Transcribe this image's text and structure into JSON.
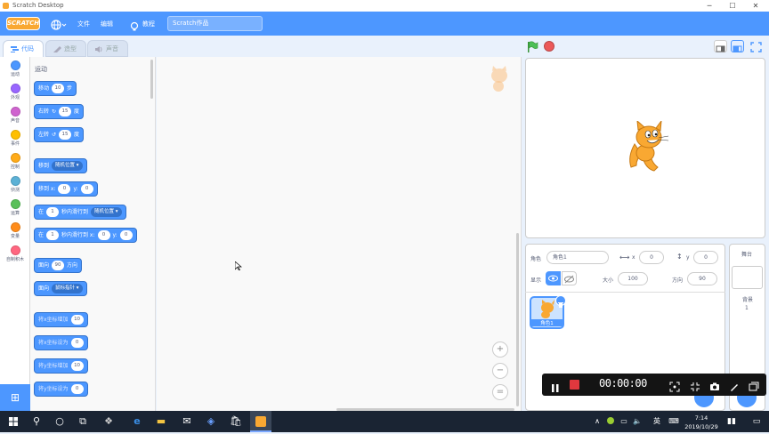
{
  "window": {
    "title": "Scratch Desktop",
    "minimize": "─",
    "maximize": "☐",
    "close": "✕"
  },
  "menubar": {
    "logo": "SCRATCH",
    "language_icon": "globe-icon",
    "file": "文件",
    "edit": "编辑",
    "tutorials": "教程",
    "project_title": "Scratch作品"
  },
  "tabs": [
    {
      "label": "代码"
    },
    {
      "label": "造型"
    },
    {
      "label": "声音"
    }
  ],
  "categories": [
    {
      "label": "运动",
      "color": "#4c97ff"
    },
    {
      "label": "外观",
      "color": "#9966ff"
    },
    {
      "label": "声音",
      "color": "#cf63cf"
    },
    {
      "label": "事件",
      "color": "#ffbf00"
    },
    {
      "label": "控制",
      "color": "#ffab19"
    },
    {
      "label": "侦测",
      "color": "#5cb1d6"
    },
    {
      "label": "运算",
      "color": "#59c059"
    },
    {
      "label": "变量",
      "color": "#ff8c1a"
    },
    {
      "label": "自制积木",
      "color": "#ff6680"
    }
  ],
  "palette": {
    "heading": "运动",
    "move": {
      "a": "移动",
      "n": "10",
      "b": "步"
    },
    "turn_right": {
      "a": "右转",
      "n": "15",
      "b": "度"
    },
    "turn_left": {
      "a": "左转",
      "n": "15",
      "b": "度"
    },
    "goto": {
      "a": "移到",
      "dd": "随机位置"
    },
    "goto_xy": {
      "a": "移到 x:",
      "x": "0",
      "yl": "y:",
      "y": "0"
    },
    "glide": {
      "a": "在",
      "n": "1",
      "b": "秒内滑行到",
      "dd": "随机位置"
    },
    "glide_xy": {
      "a": "在",
      "n": "1",
      "b": "秒内滑行到 x:",
      "x": "0",
      "yl": "y:",
      "y": "0"
    },
    "point_dir": {
      "a": "面向",
      "n": "90",
      "b": "方向"
    },
    "point_towards": {
      "a": "面向",
      "dd": "鼠标指针"
    },
    "change_x": {
      "a": "将x坐标增加",
      "n": "10"
    },
    "set_x": {
      "a": "将x坐标设为",
      "n": "0"
    },
    "change_y": {
      "a": "将y坐标增加",
      "n": "10"
    },
    "set_y": {
      "a": "将y坐标设为",
      "n": "0"
    }
  },
  "zoom": {
    "in": "+",
    "out": "−",
    "reset": "="
  },
  "sprite_info": {
    "sprite_label": "角色",
    "sprite_name": "角色1",
    "x_label": "x",
    "x": "0",
    "y_label": "y",
    "y": "0",
    "show_label": "显示",
    "size_label": "大小",
    "size": "100",
    "direction_label": "方向",
    "direction": "90"
  },
  "sprite_list": [
    {
      "name": "角色1"
    }
  ],
  "stage_panel": {
    "title": "舞台",
    "backdrops_label": "背景",
    "backdrops_count": "1"
  },
  "recorder": {
    "time": "00:00:00"
  },
  "taskbar": {
    "time": "7:14",
    "date": "2019/10/29",
    "ime": "英"
  }
}
